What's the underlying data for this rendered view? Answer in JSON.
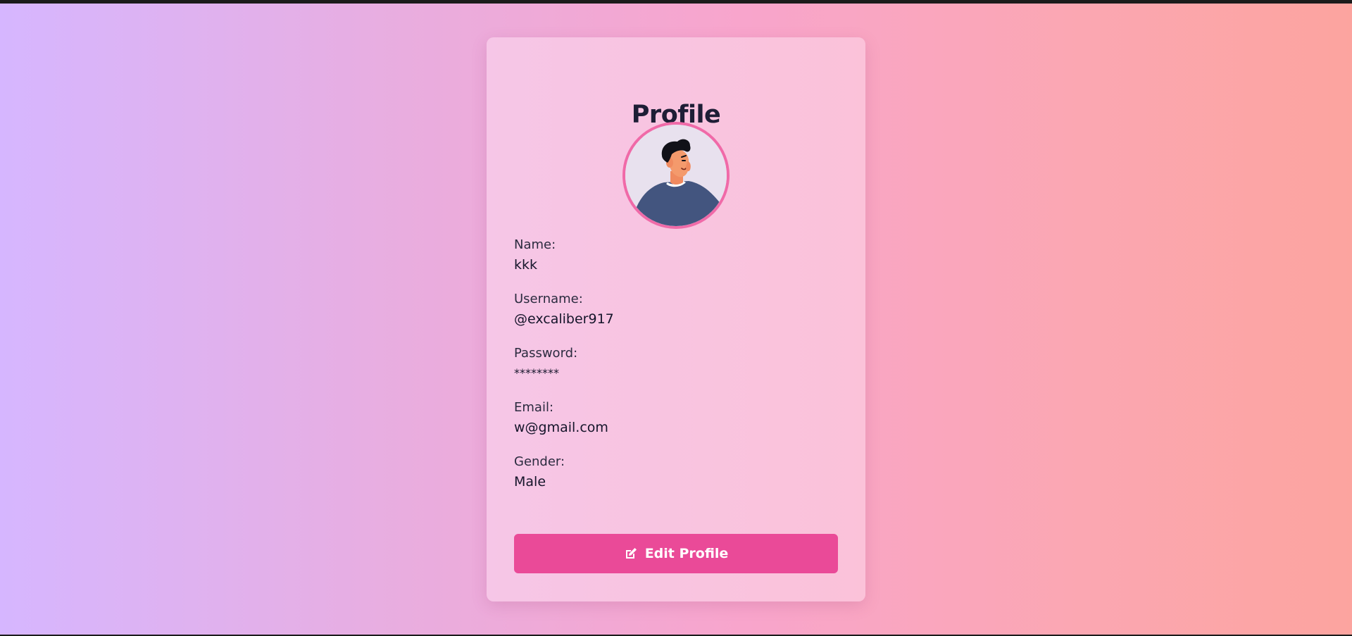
{
  "page": {
    "title": "Profile",
    "colors": {
      "accent": "#ea4a98",
      "avatar_ring": "#f06aa8",
      "card": "#f8c4df"
    }
  },
  "avatar": {
    "icon": "user-avatar-illustration"
  },
  "fields": [
    {
      "label": "Name:",
      "value": "kkk"
    },
    {
      "label": "Username:",
      "value": "@excaliber917"
    },
    {
      "label": "Password:",
      "value": "********"
    },
    {
      "label": "Email:",
      "value": "w@gmail.com"
    },
    {
      "label": "Gender:",
      "value": "Male"
    }
  ],
  "actions": {
    "edit_label": "Edit Profile",
    "edit_icon": "edit-icon"
  }
}
